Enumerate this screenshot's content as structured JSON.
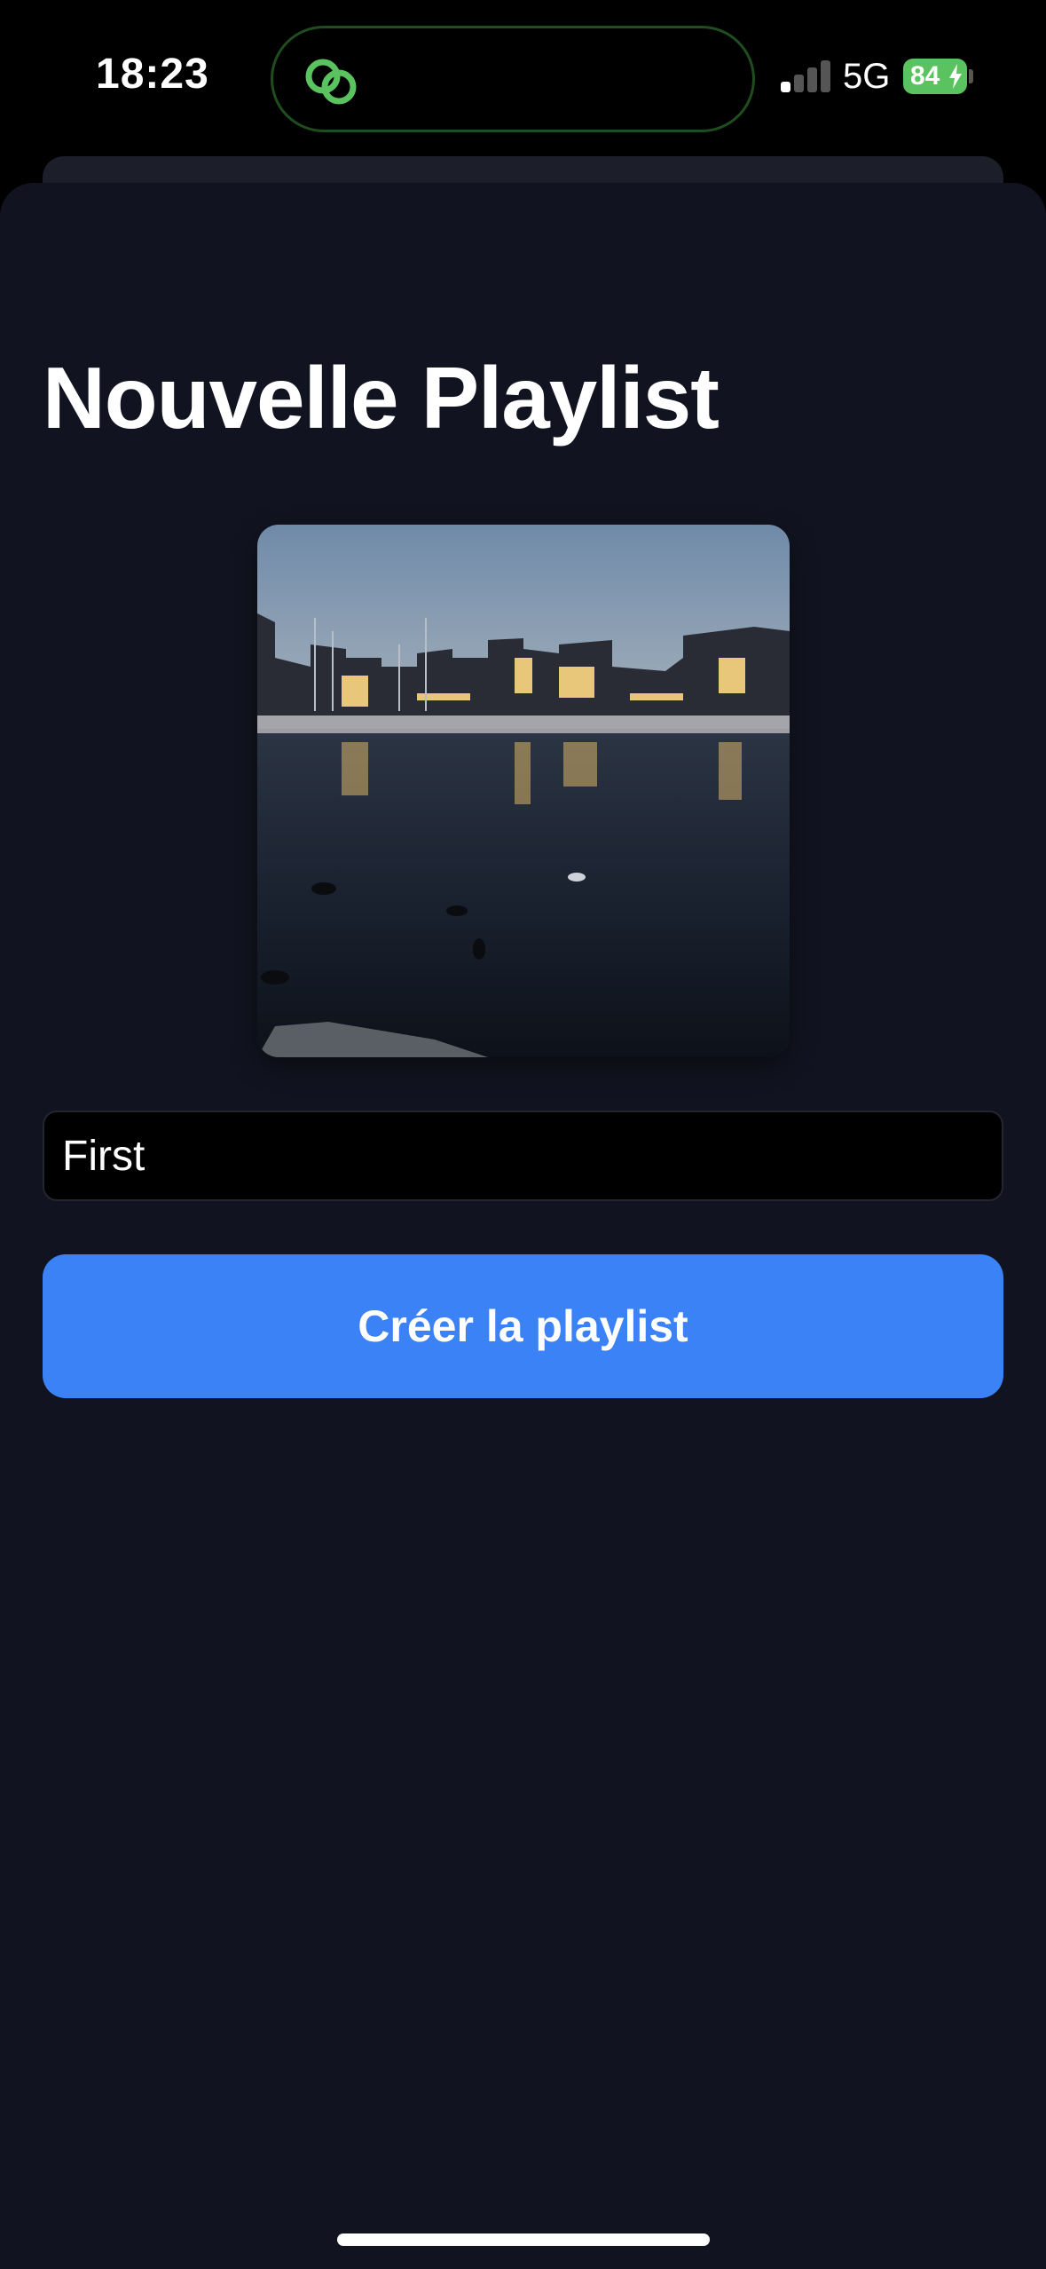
{
  "status_bar": {
    "time": "18:23",
    "network": "5G",
    "battery": "84",
    "signal_bars_active": 1,
    "accent_color": "#5ac35f"
  },
  "sheet": {
    "title": "Nouvelle Playlist"
  },
  "cover_image": {
    "description_icon": "photo-harbor-night"
  },
  "form": {
    "name_value": "First",
    "create_label": "Créer la playlist",
    "button_color": "#3b82f6"
  }
}
